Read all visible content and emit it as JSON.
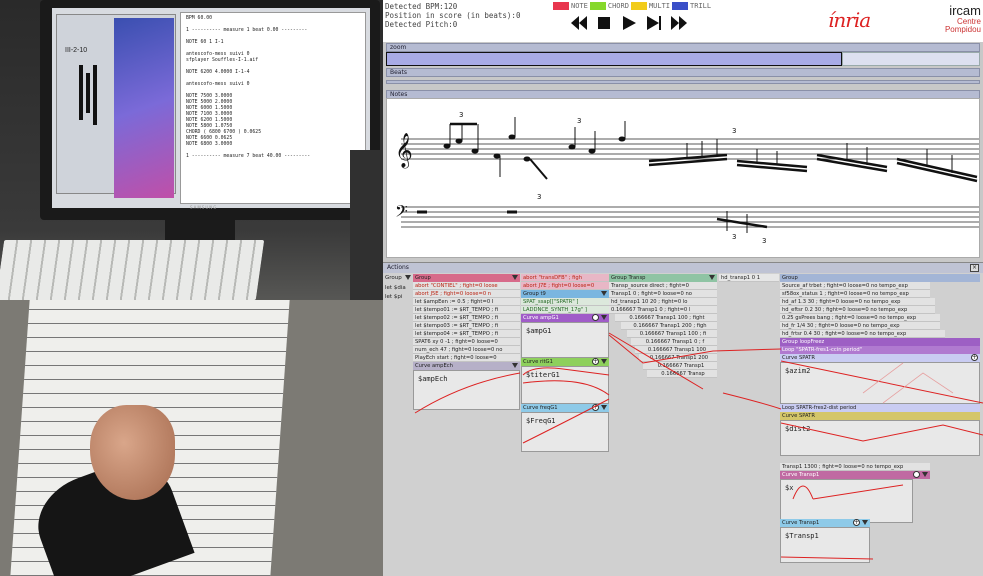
{
  "photo": {
    "monitor_brand": "SAMSUNG",
    "screen_label": "III-2-10",
    "screen_code": "BPM 60.00\n\n1 ---------- measure 1 beat 0.00 ---------\n\nNOTE 60 1 I-1\n\nantescofo-mess suivi 0\nsfplayer Souffles-I-1.aif\n\nNOTE 6200 4.0000 I-1-4\n\nantescofo-mess suivi 0\n\nNOTE 7500 3.0000\nNOTE 5000 2.0000\nNOTE 6000 1.5000\nNOTE 7100 3.0000\nNOTE 6200 1.5000\nNOTE 5800 1.0750\nCHORD ( 6800 6700 ) 0.0625\nNOTE 6600 0.0625\nNOTE 6800 3.0000\n\n1 ---------- measure 7 beat 40.00 ---------"
  },
  "app": {
    "detected_bpm": "Detected BPM:120",
    "position": "Position in score (in beats):0",
    "detected_pitch": "Detected Pitch:0",
    "legend": [
      {
        "label": "NOTE",
        "color": "#e8364e"
      },
      {
        "label": "CHORD",
        "color": "#86d82a"
      },
      {
        "label": "MULTI",
        "color": "#f2cc1a"
      },
      {
        "label": "TRILL",
        "color": "#3a4fc8"
      }
    ],
    "transport": [
      {
        "name": "rewind-icon"
      },
      {
        "name": "stop-icon"
      },
      {
        "name": "play-icon"
      },
      {
        "name": "step-forward-icon"
      },
      {
        "name": "fast-forward-icon"
      }
    ],
    "logos": {
      "inria": "ínria",
      "ircam": "ircam",
      "centre": "Centre",
      "pompidou": "Pompidou"
    },
    "panes": {
      "zoom": "zoom",
      "beats": "Beats",
      "notes": "Notes",
      "actions": "Actions",
      "close": "×"
    }
  },
  "actions": {
    "side_labels": [
      "Group",
      "let $dia",
      "let $pi"
    ],
    "group_a": {
      "head": "Group",
      "rows": [
        {
          "text": "abort \"CONTIEL\" ; fight=0 loose",
          "style": "red"
        },
        {
          "text": "abort J5E ; fight=0 loose=0 n",
          "style": "red"
        },
        {
          "text": "let $ampEen := 0.5 ; fight=0 I",
          "style": ""
        },
        {
          "text": "let $tempo01 := $RT_TEMPO ; fi",
          "style": ""
        },
        {
          "text": "let $tempo02 := $RT_TEMPO ; fi",
          "style": ""
        },
        {
          "text": "let $tempo03 := $RT_TEMPO ; fi",
          "style": ""
        },
        {
          "text": "let $tempo04 := $RT_TEMPO ; fi",
          "style": ""
        },
        {
          "text": "SPAT6 xy 0 -1 ; fight=0 loose=0",
          "style": ""
        },
        {
          "text": "num_ech 47 ; fight=0 loose=0 no",
          "style": ""
        },
        {
          "text": "PlayEch start ; fight=0 loose=0",
          "style": ""
        }
      ],
      "curve_head": "Curve ampEch",
      "curve_var": "$ampEch"
    },
    "group_b": {
      "rows": [
        {
          "text": "abort \"transDFB\" ; figh",
          "style": "red"
        },
        {
          "text": "abort J7E ; fight=0 loose=0",
          "style": "red"
        }
      ],
      "group_head": "Group t9",
      "green_rows": [
        {
          "text": "SPAT_ssap[[\"SPATR\" ]",
          "style": "green"
        },
        {
          "text": "LADDNCE_SYNTH_17g\" ]",
          "style": "green"
        }
      ],
      "curve1_head": "Curve ampG1",
      "curve1_var": "$ampG1",
      "curve2_head": "Curve ritG1",
      "curve2_var": "$titerG1",
      "curve3_head": "Curve freqG1",
      "curve3_var": "$FreqG1"
    },
    "group_c": {
      "head": "Group Transp",
      "rows": [
        {
          "text": "Transp_source direct ; fight=0",
          "style": ""
        },
        {
          "text": "Transp1 0 ; fight=0 loose=0 no",
          "style": ""
        },
        {
          "text": "hd_transp1 10 20 ; fight=0 lo",
          "style": ""
        },
        {
          "text": "0.166667 Transp1 0 ; fight=0 l",
          "style": ""
        },
        {
          "text": "0.166667 Transp1 100 ; fight",
          "style": ""
        },
        {
          "text": "0.166667 Transp1 200 ; figh",
          "style": ""
        },
        {
          "text": "0.166667 Transp1 100 ; fi",
          "style": ""
        },
        {
          "text": "0.166667 Transp1 0 ; f",
          "style": ""
        },
        {
          "text": "0.166667 Transp1 100",
          "style": ""
        },
        {
          "text": "0.166667 Transp1 200",
          "style": ""
        },
        {
          "text": "0.166667 Transp1",
          "style": ""
        },
        {
          "text": "0.166667 Transp",
          "style": ""
        }
      ]
    },
    "group_d": {
      "head_small": "hd_transp1 0 1",
      "head": "Group",
      "rows": [
        {
          "text": "Source_af trbet ; fight=0 loose=0 no tempo_exp",
          "style": ""
        },
        {
          "text": "sf58ox_status 1 ; fight=0 loose=0 no tempo_exp",
          "style": ""
        },
        {
          "text": "hd_af 1.3 30 ; fight=0 loose=0 no tempo_exp",
          "style": ""
        },
        {
          "text": "hd_eftsr 0.2 30 ; fight=0 loose=0 no tempo_exp",
          "style": ""
        },
        {
          "text": "0.25 gsPrees bang ; fight=0 loose=0 no tempo_exp",
          "style": ""
        },
        {
          "text": "hd_fr 1/4 30 ; fight=0 loose=0 no tempo_exp",
          "style": ""
        },
        {
          "text": "hd_frtsr 0.4 30 ; fight=0 loose=0 no tempo_exp",
          "style": ""
        }
      ],
      "group2": "Group loopFreez",
      "loop1": "Loop \"SPATR-fres1-ccin period\"",
      "curve1_head": "Curve SPATR",
      "curve1_var": "$azim2",
      "loop2": "Loop SPATR-fres2-dist period",
      "curve2_head": "Curve SPATR",
      "curve2_var": "$dist2",
      "transp_row": "Transp1 1300 ; fight=0 loose=0 no tempo_exp",
      "curve3_head": "Curve Transp1",
      "curve3_var": "$x",
      "curve4_head": "Curve Transp1",
      "curve4_var": "$Transp1"
    }
  }
}
